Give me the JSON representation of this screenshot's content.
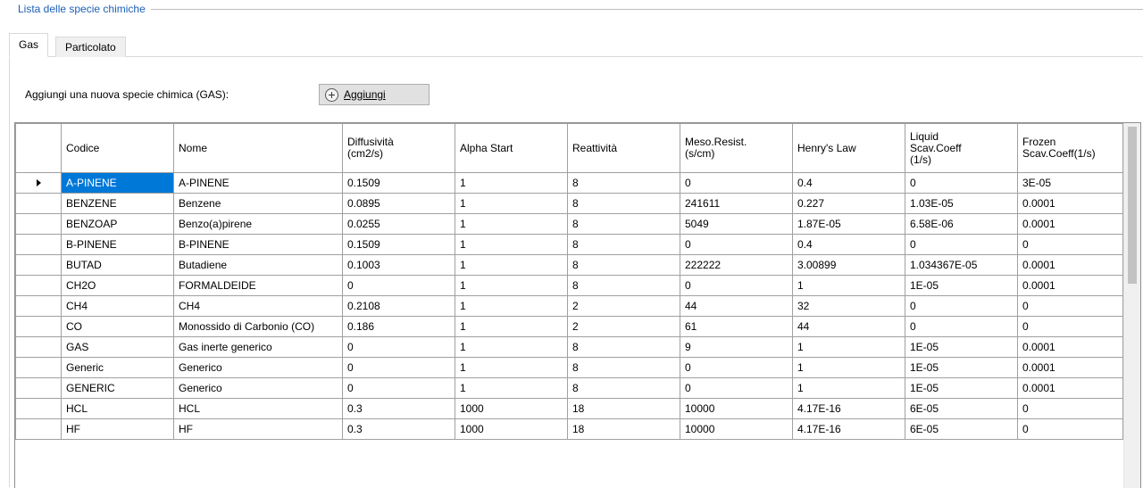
{
  "groupbox": {
    "title": "Lista delle specie chimiche"
  },
  "tabs": [
    {
      "label": "Gas",
      "active": true
    },
    {
      "label": "Particolato",
      "active": false
    }
  ],
  "add": {
    "label": "Aggiungi una nuova specie chimica (GAS):",
    "button_label": "Aggiungi",
    "icon": "plus-circle-icon"
  },
  "grid": {
    "columns": [
      "Codice",
      "Nome",
      "Diffusività\n(cm2/s)",
      "Alpha Start",
      "Reattività",
      "Meso.Resist.\n(s/cm)",
      "Henry's Law",
      "Liquid\nScav.Coeff\n(1/s)",
      "Frozen\nScav.Coeff(1/s)"
    ],
    "selected_row": 0,
    "selection_color": "#0078d7",
    "rows": [
      [
        "A-PINENE",
        "A-PINENE",
        "0.1509",
        "1",
        "8",
        "0",
        "0.4",
        "0",
        "3E-05"
      ],
      [
        "BENZENE",
        "Benzene",
        "0.0895",
        "1",
        "8",
        "241611",
        "0.227",
        "1.03E-05",
        "0.0001"
      ],
      [
        "BENZOAP",
        "Benzo(a)pirene",
        "0.0255",
        "1",
        "8",
        "5049",
        "1.87E-05",
        "6.58E-06",
        "0.0001"
      ],
      [
        "B-PINENE",
        "B-PINENE",
        "0.1509",
        "1",
        "8",
        "0",
        "0.4",
        "0",
        "0"
      ],
      [
        "BUTAD",
        "Butadiene",
        "0.1003",
        "1",
        "8",
        "222222",
        "3.00899",
        "1.034367E-05",
        "0.0001"
      ],
      [
        "CH2O",
        "FORMALDEIDE",
        "0",
        "1",
        "8",
        "0",
        "1",
        "1E-05",
        "0.0001"
      ],
      [
        "CH4",
        "CH4",
        "0.2108",
        "1",
        "2",
        "44",
        "32",
        "0",
        "0"
      ],
      [
        "CO",
        "Monossido di Carbonio (CO)",
        "0.186",
        "1",
        "2",
        "61",
        "44",
        "0",
        "0"
      ],
      [
        "GAS",
        "Gas inerte generico",
        "0",
        "1",
        "8",
        "9",
        "1",
        "1E-05",
        "0.0001"
      ],
      [
        "Generic",
        "Generico",
        "0",
        "1",
        "8",
        "0",
        "1",
        "1E-05",
        "0.0001"
      ],
      [
        "GENERIC",
        "Generico",
        "0",
        "1",
        "8",
        "0",
        "1",
        "1E-05",
        "0.0001"
      ],
      [
        "HCL",
        "HCL",
        "0.3",
        "1000",
        "18",
        "10000",
        "4.17E-16",
        "6E-05",
        "0"
      ],
      [
        "HF",
        "HF",
        "0.3",
        "1000",
        "18",
        "10000",
        "4.17E-16",
        "6E-05",
        "0"
      ]
    ]
  }
}
